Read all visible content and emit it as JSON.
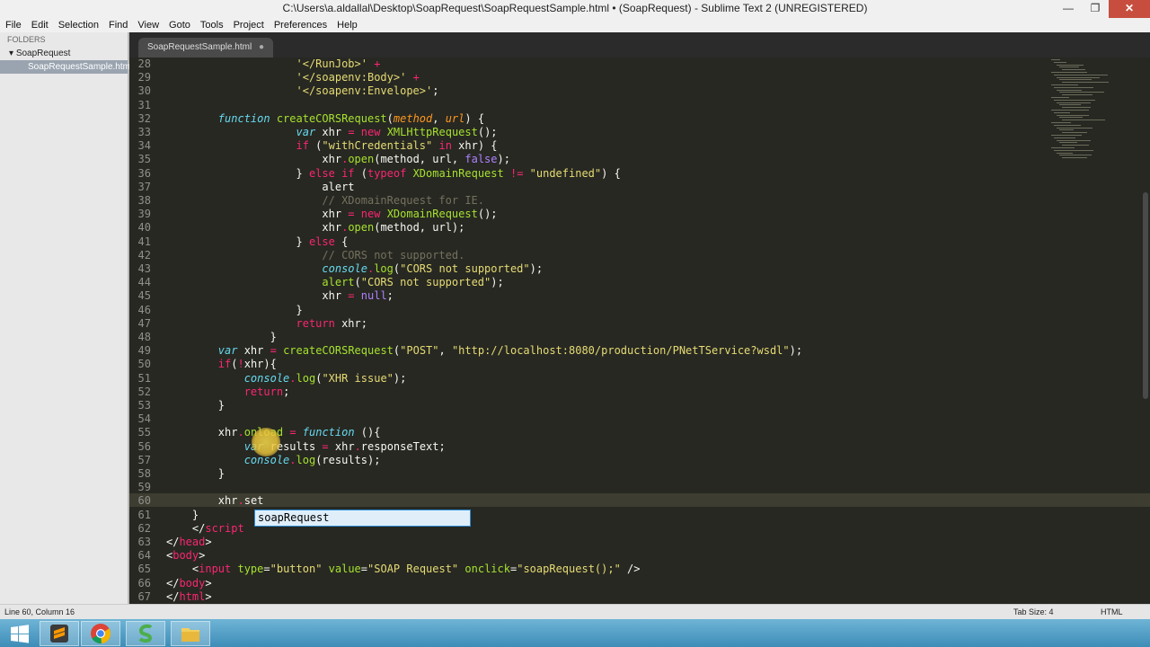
{
  "window": {
    "title": "C:\\Users\\a.aldallal\\Desktop\\SoapRequest\\SoapRequestSample.html • (SoapRequest) - Sublime Text 2 (UNREGISTERED)",
    "minimize": "—",
    "maximize": "❐",
    "close": "✕"
  },
  "menu": [
    "File",
    "Edit",
    "Selection",
    "Find",
    "View",
    "Goto",
    "Tools",
    "Project",
    "Preferences",
    "Help"
  ],
  "sidebar": {
    "header": "FOLDERS",
    "folder": "SoapRequest",
    "file": "SoapRequestSample.html"
  },
  "tab": {
    "label": "SoapRequestSample.html",
    "dirty": "●"
  },
  "editor": {
    "line_numbers": [
      "28",
      "29",
      "30",
      "31",
      "32",
      "33",
      "34",
      "35",
      "36",
      "37",
      "38",
      "39",
      "40",
      "41",
      "42",
      "43",
      "44",
      "45",
      "46",
      "47",
      "48",
      "49",
      "50",
      "51",
      "52",
      "53",
      "54",
      "55",
      "56",
      "57",
      "58",
      "59",
      "60",
      "61",
      "62",
      "63",
      "64",
      "65",
      "66",
      "67"
    ],
    "autocomplete": "soapRequest"
  },
  "status": {
    "position": "Line 60, Column 16",
    "tab_size": "Tab Size: 4",
    "syntax": "HTML"
  },
  "taskbar": {
    "items": [
      "windows-start-icon",
      "sublime-text-icon",
      "chrome-icon",
      "green-s-app-icon",
      "file-explorer-icon"
    ]
  },
  "colors": {
    "editor_bg": "#272822",
    "keyword": "#f92672",
    "string": "#e6db74",
    "comment": "#75715e",
    "function": "#a6e22e",
    "storage": "#66d9ef"
  }
}
